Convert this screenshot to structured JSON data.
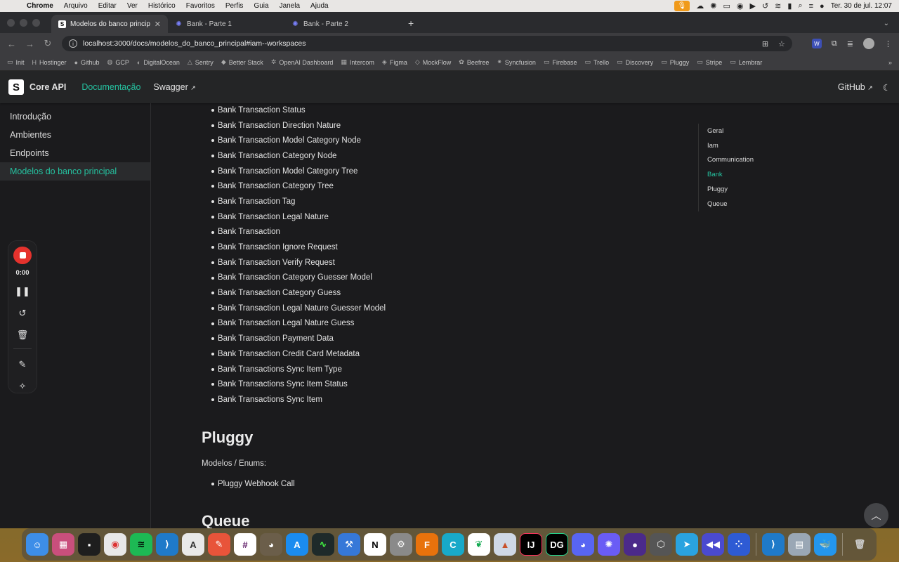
{
  "menubar": {
    "items": [
      "Chrome",
      "Arquivo",
      "Editar",
      "Ver",
      "Histórico",
      "Favoritos",
      "Perfis",
      "Guia",
      "Janela",
      "Ajuda"
    ],
    "clock": "Ter. 30 de jul.  12:07"
  },
  "tabs": [
    {
      "title": "Modelos do banco principal |",
      "icon": "docusaurus-icon",
      "active": true
    },
    {
      "title": "Bank - Parte 1",
      "icon": "star-icon",
      "active": false
    },
    {
      "title": "Bank - Parte 2",
      "icon": "star-icon",
      "active": false
    }
  ],
  "address": {
    "url": "localhost:3000/docs/modelos_do_banco_principal#iam--workspaces"
  },
  "bookmarks": [
    "Init",
    "Hostinger",
    "Github",
    "GCP",
    "DigitalOcean",
    "Sentry",
    "Better Stack",
    "OpenAI Dashboard",
    "Intercom",
    "Figma",
    "MockFlow",
    "Beefree",
    "Syncfusion",
    "Firebase",
    "Trello",
    "Discovery",
    "Pluggy",
    "Stripe",
    "Lembrar"
  ],
  "site": {
    "brand": "Core API",
    "nav": {
      "docs": "Documentação",
      "swagger": "Swagger",
      "github": "GitHub"
    }
  },
  "sidebar": {
    "items": [
      {
        "label": "Introdução",
        "active": false
      },
      {
        "label": "Ambientes",
        "active": false
      },
      {
        "label": "Endpoints",
        "active": false
      },
      {
        "label": "Modelos do banco principal",
        "active": true
      }
    ]
  },
  "content": {
    "bank_items": [
      "Bank Transaction Status",
      "Bank Transaction Direction Nature",
      "Bank Transaction Model Category Node",
      "Bank Transaction Category Node",
      "Bank Transaction Model Category Tree",
      "Bank Transaction Category Tree",
      "Bank Transaction Tag",
      "Bank Transaction Legal Nature",
      "Bank Transaction",
      "Bank Transaction Ignore Request",
      "Bank Transaction Verify Request",
      "Bank Transaction Category Guesser Model",
      "Bank Transaction Category Guess",
      "Bank Transaction Legal Nature Guesser Model",
      "Bank Transaction Legal Nature Guess",
      "Bank Transaction Payment Data",
      "Bank Transaction Credit Card Metadata",
      "Bank Transactions Sync Item Type",
      "Bank Transactions Sync Item Status",
      "Bank Transactions Sync Item"
    ],
    "pluggy_heading": "Pluggy",
    "pluggy_intro": "Modelos / Enums:",
    "pluggy_items": [
      "Pluggy Webhook Call"
    ],
    "queue_heading": "Queue"
  },
  "toc": [
    {
      "label": "Geral",
      "active": false
    },
    {
      "label": "Iam",
      "active": false
    },
    {
      "label": "Communication",
      "active": false
    },
    {
      "label": "Bank",
      "active": true
    },
    {
      "label": "Pluggy",
      "active": false
    },
    {
      "label": "Queue",
      "active": false
    }
  ],
  "recorder": {
    "time": "0:00"
  },
  "accent_color": "#25c2a0",
  "dock": [
    "finder-icon",
    "launchpad-icon",
    "terminal-icon",
    "chrome-icon",
    "spotify-icon",
    "vscode-icon",
    "fontforge-icon",
    "pencil-icon",
    "slack-icon",
    "gimp-icon",
    "appstore-icon",
    "activity-monitor-icon",
    "xcode-icon",
    "notion-icon",
    "system-settings-icon",
    "fusion360-icon",
    "cursor-icon",
    "mongodb-icon",
    "matlab-icon",
    "intellij-icon",
    "datagrip-icon",
    "discord-icon",
    "pinwheel-icon",
    "ball-icon",
    "unity-icon",
    "telegram-icon",
    "rewind-icon",
    "network-icon",
    "vscode-2-icon",
    "preview-icon",
    "docker-icon",
    "trash-icon"
  ]
}
